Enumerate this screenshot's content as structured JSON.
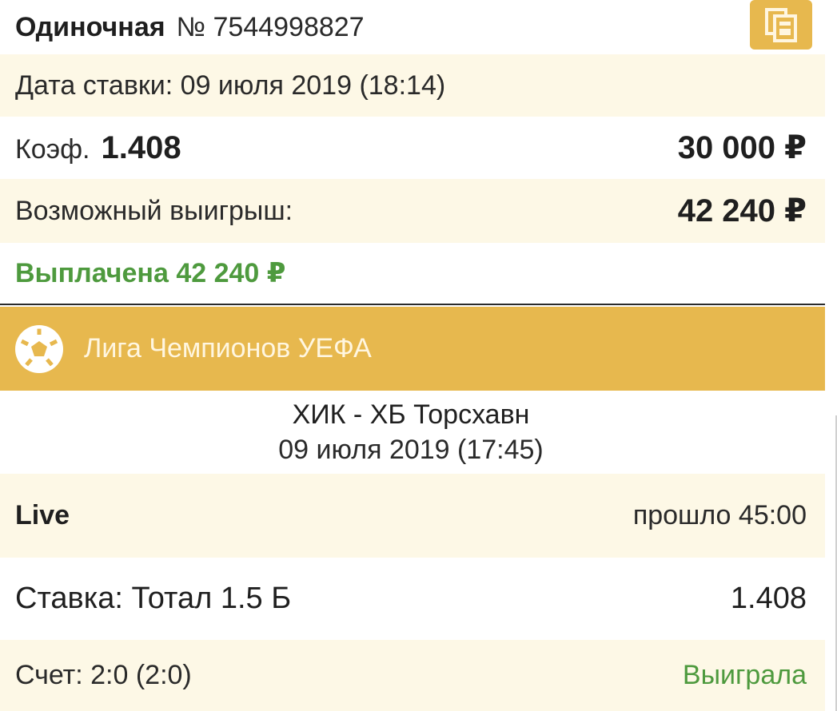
{
  "header": {
    "bet_type": "Одиночная",
    "bet_number": "№ 7544998827",
    "copy_icon": "copy-icon"
  },
  "date_row": {
    "text": "Дата ставки: 09 июля 2019 (18:14)"
  },
  "odds_row": {
    "label": "Коэф.",
    "value": "1.408",
    "stake": "30 000 ₽"
  },
  "win_row": {
    "label": "Возможный выигрыш:",
    "value": "42 240 ₽"
  },
  "paid_row": {
    "text": "Выплачена 42 240 ₽"
  },
  "league": {
    "icon": "soccer-ball-icon",
    "name": "Лига Чемпионов УЕФА"
  },
  "match": {
    "title": "ХИК - ХБ Торсхавн",
    "date": "09 июля 2019 (17:45)"
  },
  "live_row": {
    "label": "Live",
    "elapsed": "прошло 45:00"
  },
  "bet_row": {
    "label": "Ставка: Тотал 1.5 Б",
    "odds": "1.408"
  },
  "score_row": {
    "label": "Счет: 2:0 (2:0)",
    "status": "Выиграла"
  },
  "colors": {
    "accent": "#e7b84e",
    "cream": "#fdf8e6",
    "green": "#4e9a3e"
  }
}
